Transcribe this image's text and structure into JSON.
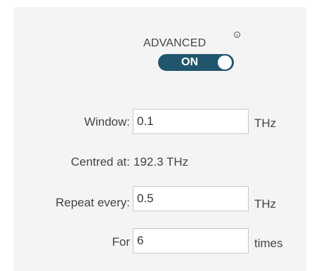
{
  "advanced": {
    "label": "ADVANCED",
    "toggle_text": "ON",
    "toggle_state": "on",
    "toggle_color": "#20566d"
  },
  "window": {
    "label": "Window:",
    "value": "0.1",
    "unit": "THz"
  },
  "centred": {
    "label": "Centred at:",
    "value": "192.3 THz"
  },
  "repeat": {
    "label": "Repeat every:",
    "value": "0.5",
    "unit": "THz"
  },
  "for": {
    "label": "For",
    "value": "6",
    "unit": "times"
  },
  "icons": {
    "info": "info-icon"
  }
}
